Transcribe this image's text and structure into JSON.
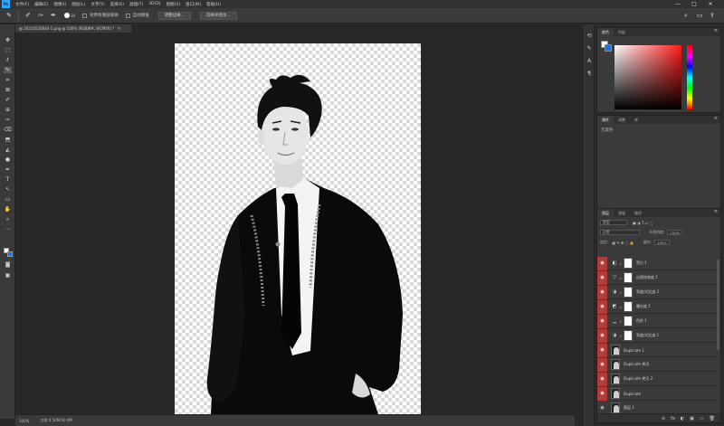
{
  "app": {
    "logo": "Ps"
  },
  "menu": [
    "文件(F)",
    "编辑(E)",
    "图像(I)",
    "图层(L)",
    "文字(Y)",
    "选择(S)",
    "滤镜(T)",
    "3D(D)",
    "视图(V)",
    "窗口(W)",
    "帮助(H)"
  ],
  "window_controls": {
    "minimize": "—",
    "maximize": "□",
    "close": "✕"
  },
  "options_bar": {
    "brush_size": "30",
    "sample_all_label": "对所有图层取样",
    "auto_enhance_label": "自动增强",
    "refine_edge_label": "调整边缘...",
    "select_subject_label": "选择并遮住...",
    "search_icon": "⌕",
    "workspace_icon": "▭",
    "share_icon": "⇪"
  },
  "document": {
    "tab_label": "@ 20210520040-1.png @ 100% (RGB/8#, 8/CMYK) *",
    "close": "×"
  },
  "status_bar": {
    "zoom": "100%",
    "doc_info": "文档:4.50M/30.4M"
  },
  "color_panel": {
    "tabs": [
      "颜色",
      "色板"
    ],
    "accent_field_color": "#ff1a1a"
  },
  "properties_panel": {
    "tabs": [
      "属性",
      "调整",
      "库"
    ],
    "empty_label": "无属性"
  },
  "layers_panel": {
    "tabs": [
      "图层",
      "通道",
      "路径"
    ],
    "kind_filter": "类型",
    "blend_mode": "正常",
    "opacity_label": "不透明度:",
    "opacity_value": "100%",
    "lock_label": "锁定:",
    "fill_label": "填充:",
    "fill_value": "100%",
    "footer_icons": [
      "⊝",
      "fx",
      "◐",
      "▣",
      "▭",
      "🗑"
    ],
    "layers": [
      {
        "name": "黑白 1",
        "type": "adjustment",
        "icon": "◧",
        "visible": true
      },
      {
        "name": "自然饱和度 1",
        "type": "adjustment",
        "icon": "▽",
        "visible": true
      },
      {
        "name": "亮度/对比度 2",
        "type": "adjustment",
        "icon": "◑",
        "visible": true
      },
      {
        "name": "曝光度 1",
        "type": "adjustment",
        "icon": "◩",
        "visible": true
      },
      {
        "name": "色阶 1",
        "type": "adjustment",
        "icon": "▁",
        "visible": true
      },
      {
        "name": "亮度/对比度 1",
        "type": "adjustment",
        "icon": "◑",
        "visible": true
      },
      {
        "name": "Duplicate 1",
        "type": "image",
        "icon": "",
        "visible": true
      },
      {
        "name": "Duplicate 拷贝",
        "type": "image",
        "icon": "",
        "visible": true
      },
      {
        "name": "Duplicate 拷贝 2",
        "type": "image",
        "icon": "",
        "visible": true
      },
      {
        "name": "Duplicate",
        "type": "image",
        "icon": "",
        "visible": true
      },
      {
        "name": "图层 1",
        "type": "image",
        "icon": "",
        "visible": true
      }
    ]
  },
  "tools": [
    "✥",
    "⬚",
    "ℓ",
    "✎",
    "⌗",
    "⊠",
    "✐",
    "⊕",
    "✑",
    "⌫",
    "⬒",
    "◭",
    "●",
    "✒",
    "T",
    "↖",
    "▭",
    "✋",
    "⌕",
    "⋯"
  ]
}
